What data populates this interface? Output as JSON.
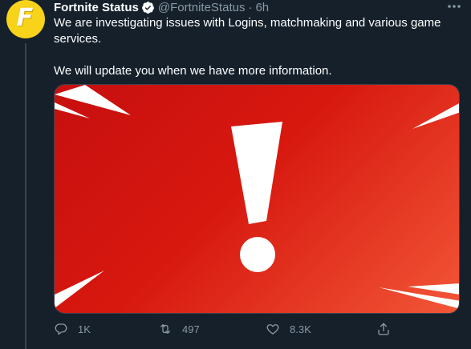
{
  "tweet": {
    "avatar_letter": "F",
    "display_name": "Fortnite Status",
    "handle": "@FortniteStatus",
    "separator": "·",
    "time": "6h",
    "paragraphs": [
      "We are investigating issues with Logins, matchmaking and various game services.",
      "We will update you when we have more information."
    ],
    "media": {
      "description_icon": "exclamation-mark",
      "colors": {
        "background_start": "#c70f0f",
        "background_end": "#f25637",
        "mark": "#ffffff"
      }
    },
    "actions": {
      "reply_count": "1K",
      "retweet_count": "497",
      "like_count": "8.3K"
    }
  },
  "theme": {
    "background": "#15202b",
    "secondary_text": "#8899a6",
    "accent": "#1da1f2",
    "avatar_bg": "#f7d319"
  }
}
